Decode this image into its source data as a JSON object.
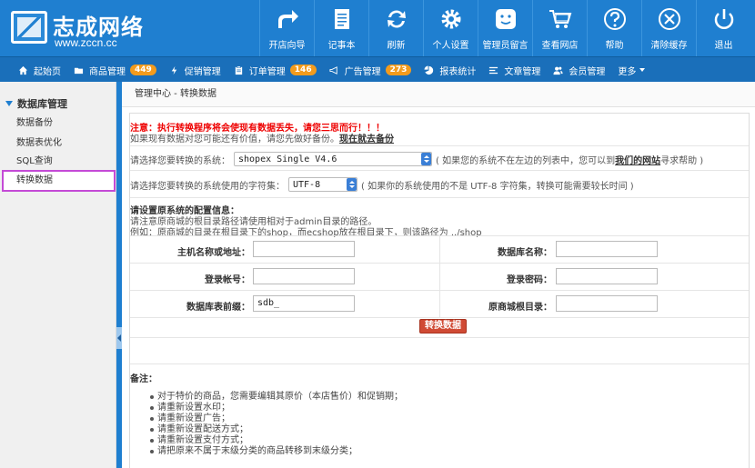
{
  "logo": {
    "title": "志成网络",
    "url": "www.zccn.cc"
  },
  "top_nav": [
    {
      "label": "开店向导",
      "icon": "share-arrow-icon"
    },
    {
      "label": "记事本",
      "icon": "notepad-icon"
    },
    {
      "label": "刷新",
      "icon": "refresh-icon"
    },
    {
      "label": "个人设置",
      "icon": "gear-icon"
    },
    {
      "label": "管理员留言",
      "icon": "smiley-icon"
    },
    {
      "label": "查看网店",
      "icon": "cart-icon"
    },
    {
      "label": "帮助",
      "icon": "help-icon"
    },
    {
      "label": "清除缓存",
      "icon": "clear-icon"
    },
    {
      "label": "退出",
      "icon": "power-icon"
    }
  ],
  "menu": [
    {
      "label": "起始页",
      "icon": "home-icon"
    },
    {
      "label": "商品管理",
      "icon": "folder-icon",
      "badge": "449"
    },
    {
      "label": "促销管理",
      "icon": "bolt-icon"
    },
    {
      "label": "订单管理",
      "icon": "clipboard-icon",
      "badge": "146"
    },
    {
      "label": "广告管理",
      "icon": "megaphone-icon",
      "badge": "273"
    },
    {
      "label": "报表统计",
      "icon": "pie-icon"
    },
    {
      "label": "文章管理",
      "icon": "list-icon"
    },
    {
      "label": "会员管理",
      "icon": "users-icon"
    },
    {
      "label": "更多",
      "icon": "caret-down-icon"
    }
  ],
  "sidebar": {
    "heading": "数据库管理",
    "items": [
      "数据备份",
      "数据表优化",
      "SQL查询",
      "转换数据"
    ],
    "active_index": 3
  },
  "breadcrumb": {
    "root": "管理中心",
    "sep": " - ",
    "current": "转换数据"
  },
  "notice": {
    "warning": "注意：执行转换程序将会使现有数据丢失，请您三思而行！！！",
    "backup_text": "如果现有数据对您可能还有价值，请您先做好备份。",
    "backup_link": "现在就去备份"
  },
  "system_select": {
    "label": "请选择您要转换的系统：",
    "value": "shopex Single V4.6",
    "hint_pre": "( 如果您的系统不在左边的列表中，您可以到",
    "hint_link": "我们的网站",
    "hint_post": "寻求帮助 )"
  },
  "charset_select": {
    "label": "请选择您要转换的系统使用的字符集：",
    "value": "UTF-8",
    "hint": "( 如果你的系统使用的不是 UTF-8 字符集，转换可能需要较长时间 )"
  },
  "config": {
    "heading": "请设置原系统的配置信息：",
    "line1": "请注意原商城的根目录路径请使用相对于admin目录的路径。",
    "line2": "例如：原商城的目录在根目录下的shop，而ecshop放在根目录下，则该路径为 ../shop"
  },
  "form": {
    "host_label": "主机名称或地址：",
    "host_value": "",
    "dbname_label": "数据库名称：",
    "dbname_value": "",
    "user_label": "登录帐号：",
    "user_value": "",
    "pass_label": "登录密码：",
    "pass_value": "",
    "prefix_label": "数据库表前缀：",
    "prefix_value": "sdb_",
    "rootdir_label": "原商城根目录：",
    "rootdir_value": ""
  },
  "submit_label": "转换数据",
  "notes": {
    "heading": "备注：",
    "items": [
      "对于特价的商品，您需要编辑其原价（本店售价）和促销期；",
      "请重新设置水印；",
      "请重新设置广告；",
      "请重新设置配送方式；",
      "请重新设置支付方式；",
      "请把原来不属于末级分类的商品转移到末级分类；"
    ]
  },
  "colors": {
    "header": "#1f7fd0",
    "menubar": "#1a6fba",
    "badge": "#f39b1c",
    "warning": "#e00000",
    "button": "#d04a34"
  }
}
